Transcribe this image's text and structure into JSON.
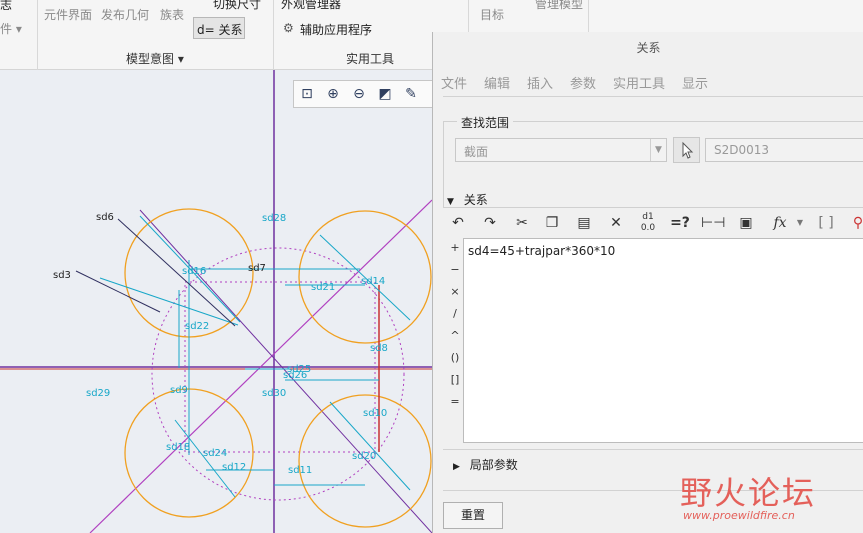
{
  "ribbon": {
    "top_row": [
      "元件界面",
      "发布几何",
      "族表"
    ],
    "left_clipped_top": "志",
    "left_clipped_mid": "件 ▾",
    "switch_dim": "切换尺寸",
    "relations_btn": "d= 关系",
    "appearance_mgr": "外观管理器",
    "aux_apps": "辅助应用程序",
    "target": "目标",
    "manage_model": "管理模型",
    "group_model_intent": "模型意图 ▾",
    "group_utilities": "实用工具"
  },
  "dialog": {
    "title": "关系",
    "menu": [
      "文件",
      "编辑",
      "插入",
      "参数",
      "实用工具",
      "显示"
    ],
    "lookup_scope_label": "查找范围",
    "scope_value": "截面",
    "section_name": "S2D0013",
    "relations_label": "关系",
    "operators": [
      "+",
      "−",
      "×",
      "/",
      "^",
      "()",
      "[]",
      "="
    ],
    "relation_text": "sd4=45+trajpar*360*10",
    "local_params_label": "局部参数",
    "reset_button": "重置"
  },
  "toolbar_icons": [
    "undo-icon",
    "redo-icon",
    "cut-icon",
    "copy-icon",
    "paste-icon",
    "delete-icon",
    "evaluate-icon",
    "verify-icon",
    "dimension-icon",
    "sort-icon",
    "function-icon",
    "brackets-icon",
    "check-icon"
  ],
  "view_toolbar_icons": [
    "refit-icon",
    "zoom-in-icon",
    "zoom-out-icon",
    "repaint-icon",
    "display-style-icon"
  ],
  "sketch": {
    "dims": {
      "sd6": "sd6",
      "sd3": "sd3",
      "sd28": "sd28",
      "sd7": "sd7",
      "sd16": "sd16",
      "sd14": "sd14",
      "sd21": "sd21",
      "sd22": "sd22",
      "sd8": "sd8",
      "sd25": "sd25",
      "sd26": "sd26",
      "sd29": "sd29",
      "sd9": "sd9",
      "sd30": "sd30",
      "sd10": "sd10",
      "sd18": "sd18",
      "sd24": "sd24",
      "sd20": "sd20",
      "sd12": "sd12",
      "sd11": "sd11"
    }
  },
  "watermark": {
    "brand": "野火论坛",
    "url": "www.proewildfire.cn"
  },
  "colors": {
    "circle": "#f0a020",
    "dimension": "#18a7c8",
    "construction": "#b040c0",
    "axis_red": "#c83232",
    "centerline": "#7030a0"
  }
}
